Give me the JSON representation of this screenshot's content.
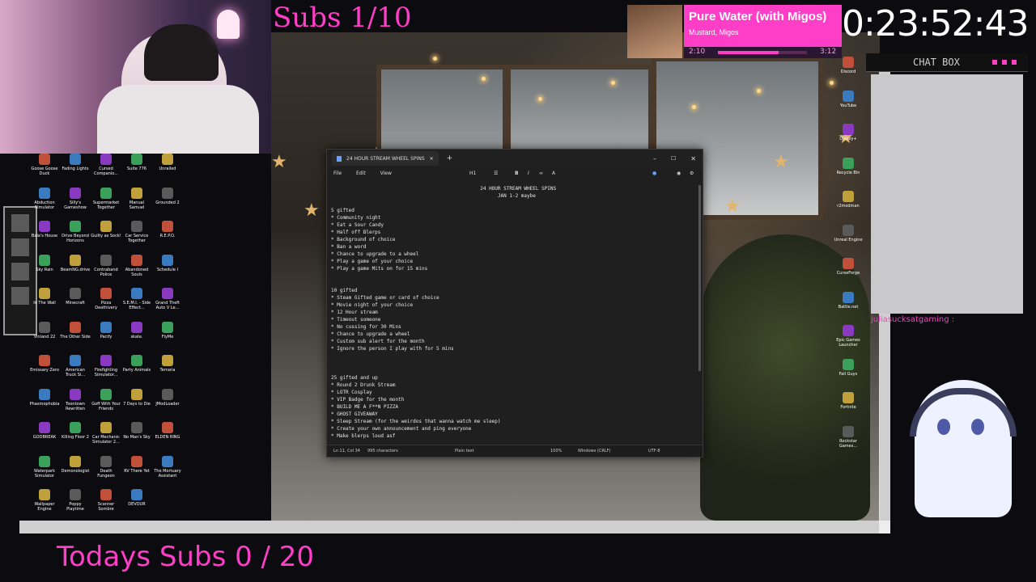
{
  "overlay": {
    "subs_goal": "Subs 1/10",
    "todays_subs": "Todays Subs 0 / 20",
    "timer": "0:23:52:43",
    "chat_box_title": "CHAT BOX",
    "chat_username": "juliasucksatgaming :"
  },
  "music": {
    "title": "Pure Water (with Migos)",
    "artist": "Mustard, Migos",
    "elapsed": "2:10",
    "duration": "3:12",
    "progress": 0.68,
    "accent": "#ff3ec8"
  },
  "notepad": {
    "tab_title": "24 HOUR STREAM WHEEL SPINS",
    "menus": [
      "File",
      "Edit",
      "View"
    ],
    "heading_label": "H1",
    "lines": [
      "                                                   24 HOUR STREAM WHEEL SPINS",
      "                                                         JAN 1-2 maybe",
      "",
      "5 gifted",
      "* Community night",
      "* Eat a Sour Candy",
      "* Half off Blerps",
      "* Background of choice",
      "* Ban a word",
      "* Chance to upgrade to a wheel",
      "* Play a game of your choice",
      "* Play a game Mits on for 15 mins",
      "",
      "",
      "10 gifted",
      "* Steam Gifted game or card of choice",
      "* Movie night of your choice",
      "* 12 Hour stream",
      "* Timeout someone",
      "* No cussing for 30 Mins",
      "* Chance to upgrade a wheel",
      "* Custom sub alert for the month",
      "* Ignore the person I play with for 5 mins",
      "",
      "",
      "",
      "25 gifted and up",
      "* Round 2 Drunk Stream",
      "* LOTR Cosplay",
      "* VIP Badge for the month",
      "* BUILD ME A F**N PIZZA",
      "* GHOST GIVEAWAY",
      "* Sleep Stream (for the weirdos that wanna watch me sleep)",
      "* Create your own announcement and ping everyone",
      "* Make blerps loud asf"
    ],
    "status": {
      "position": "Ln 11, Col 34",
      "chars": "995 characters",
      "format": "Plain text",
      "zoom": "100%",
      "line_ending": "Windows (CRLF)",
      "encoding": "UTF-8"
    }
  },
  "desktop_left": [
    [
      "Goose Goose Duck",
      "Fading Lights",
      "Cursed Companio...",
      "Suite 776",
      "Unrailed"
    ],
    [
      "Abduction Simulator",
      "Silly's Gameshow",
      "Supermarket Together",
      "Manual Samuel",
      "Grounded 2"
    ],
    [
      "Bala's House",
      "Drive Beyond Horizons",
      "Guilty as Sock!",
      "Car Service Together",
      "R.E.P.O."
    ],
    [
      "Sky Rain",
      "BeamNG.drive",
      "Contraband Police",
      "Abandoned Souls",
      "Schedule I"
    ],
    [
      "In The Wall",
      "Minecraft",
      "Pizza Deathivery",
      "S.E.M.I. - Side Effect...",
      "Grand Theft Auto V Le..."
    ],
    [
      "Vinland 22",
      "The Other Side",
      "Pacify",
      "skate.",
      "FlyMe"
    ],
    [
      "Emissary Zero",
      "American Truck Si...",
      "Firefighting Simulator...",
      "Party Animals",
      "Terraria"
    ],
    [
      "Phasmophobia",
      "Toontown Rewritten",
      "Goff With Your Friends",
      "7 Days to Die",
      "JModLoader"
    ],
    [
      "GODBREAK",
      "Killing Floor 2",
      "Car Mechanic Simulator 2...",
      "No Man's Sky",
      "ELDEN RING"
    ],
    [
      "Waterpark Simulator",
      "Demonologist",
      "Death Fungeon",
      "RV There Yet",
      "The Mortuary Assistant"
    ],
    [
      "Wallpaper Engine",
      "Poppy Playtime",
      "Scanner Sombre",
      "DEVOUR",
      ""
    ]
  ],
  "desktop_right": [
    "Discord",
    "YouTube",
    "Disney+",
    "Recycle Bin",
    "r2modman",
    "Unreal Engine",
    "CurseForge",
    "Battle.net",
    "Epic Games Launcher",
    "Fall Guys",
    "Fortnite",
    "Rockstar Games..."
  ]
}
